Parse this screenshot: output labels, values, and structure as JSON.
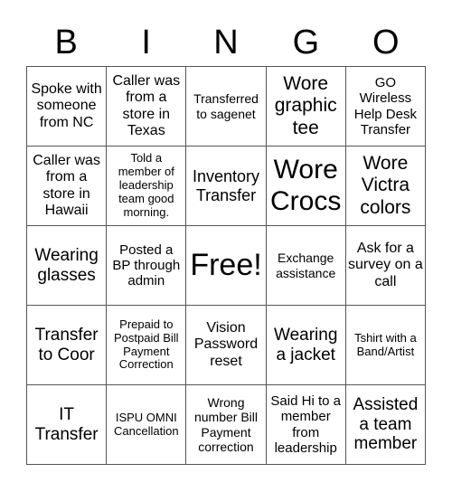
{
  "header": {
    "letters": [
      "B",
      "I",
      "N",
      "G",
      "O"
    ]
  },
  "cells": [
    "Spoke with someone from NC",
    "Caller was from a store in Texas",
    "Transferred to sagenet",
    "Wore graphic tee",
    "GO Wireless Help Desk Transfer",
    "Caller was from a store in Hawaii",
    "Told a member of leadership team good morning.",
    "Inventory Transfer",
    "Wore Crocs",
    "Wore Victra colors",
    "Wearing glasses",
    "Posted a BP through admin",
    "Free!",
    "Exchange assistance",
    "Ask for a survey on a call",
    "Transfer to Coor",
    "Prepaid to Postpaid Bill Payment Correction",
    "Vision Password reset",
    "Wearing a jacket",
    "Tshirt with a Band/Artist",
    "IT Transfer",
    "ISPU OMNI Cancellation",
    "Wrong number Bill Payment correction",
    "Said Hi to a member from leadership",
    "Assisted a team member"
  ]
}
